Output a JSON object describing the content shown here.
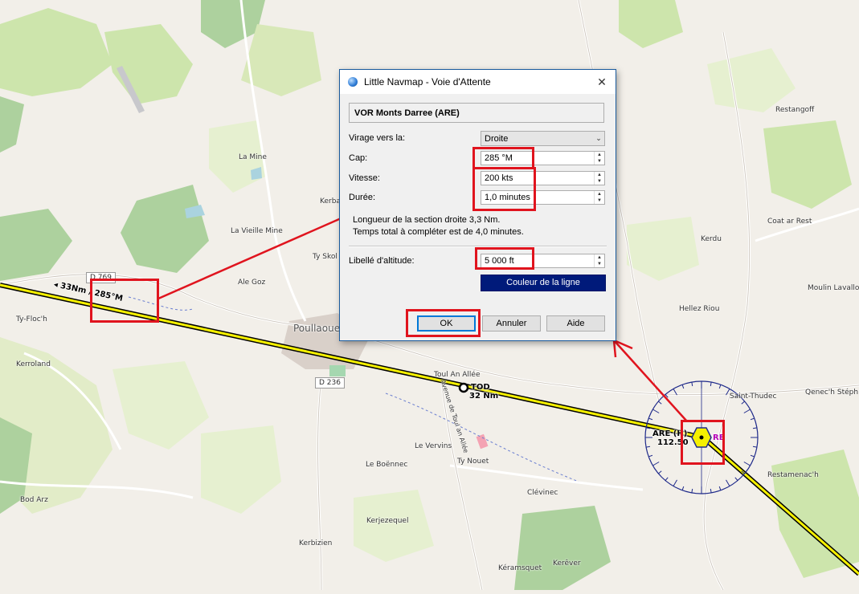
{
  "map": {
    "places": {
      "la_mine": "La Mine",
      "kerba": "Kerba",
      "la_vieille_mine": "La Vieille Mine",
      "ty_skol": "Ty Skol",
      "ale_goz": "Ale Goz",
      "ty_floch": "Ty-Floc'h",
      "kerroland": "Kerroland",
      "poullaouen": "Poullaouen",
      "toul_an_allee": "Toul An Allée",
      "avenue": "Avenue de Toul an Allée",
      "le_vervins": "Le Vervins",
      "le_boennec": "Le Boënnec",
      "ty_nouet": "Ty Nouet",
      "clevinec": "Clévinec",
      "bod_arz": "Bod Arz",
      "kerjezequel": "Kerjezequel",
      "kerbizien": "Kerbizien",
      "keramsquet": "Kéramsquet",
      "kerever": "Kerêver",
      "restangoff": "Restangoff",
      "coat_ar_rest": "Coat ar Rest",
      "kerdu": "Kerdu",
      "moulin_lavallot": "Moulin Lavallo",
      "hellez_riou": "Hellez Riou",
      "saint_thudec": "Saint-Thudec",
      "quenec": "Qenec'h Stéph",
      "restamenach": "Restamenac'h"
    },
    "roads": {
      "d236": "D 236",
      "d769": "D 769"
    },
    "route_label": "◂ 33Nm / 285°M",
    "tod_label": "TOD",
    "tod_distance": "32 Nm",
    "vor_ident_label": "ARE (H)",
    "vor_freq": "112.50",
    "vor_ident_partial": "RE"
  },
  "dialog": {
    "window_title": "Little Navmap - Voie d'Attente",
    "station": "VOR Monts Darree (ARE)",
    "turn_label": "Virage vers la:",
    "turn_value": "Droite",
    "heading_label": "Cap:",
    "heading_value": "285 °M",
    "speed_label": "Vitesse:",
    "speed_value": "200 kts",
    "duration_label": "Durée:",
    "duration_value": "1,0 minutes",
    "info_line1": "Longueur de la section droite 3,3 Nm.",
    "info_line2": "Temps total à compléter est de 4,0 minutes.",
    "altitude_label": "Libellé d'altitude:",
    "altitude_value": "5 000 ft",
    "color_button": "Couleur de la ligne",
    "ok": "OK",
    "cancel": "Annuler",
    "help": "Aide"
  },
  "colors": {
    "route": "#f5f000",
    "highlight": "#e0141e",
    "color_button": "#001a7a",
    "compass": "#1f2a8a"
  },
  "icons": {
    "window": "globe-icon",
    "close": "close-icon",
    "dropdown": "chevron-down-icon",
    "spinner": "spinner-arrows-icon",
    "vor": "vor-hexagon-icon"
  }
}
